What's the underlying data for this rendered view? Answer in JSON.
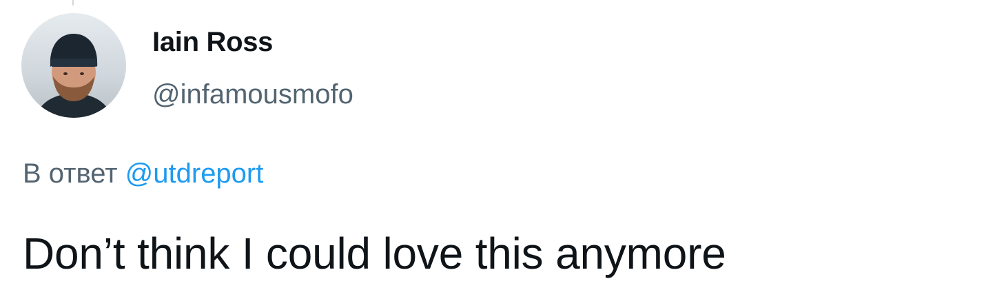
{
  "author": {
    "display_name": "Iain Ross",
    "handle": "@infamousmofo",
    "avatar_icon": "profile-photo"
  },
  "reply": {
    "prefix": "В ответ",
    "mention": "@utdreport"
  },
  "tweet": {
    "text": "Don’t think I could love this anymore"
  },
  "colors": {
    "text_primary": "#0f1419",
    "text_secondary": "#536471",
    "link": "#1d9bf0",
    "background": "#ffffff"
  }
}
